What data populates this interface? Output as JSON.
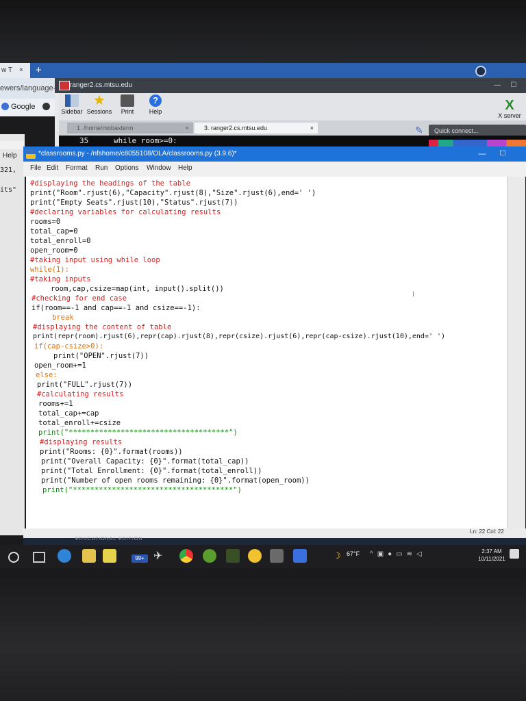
{
  "browser": {
    "tab_label": "w T",
    "tab_close": "×",
    "new_tab": "+",
    "address_partial": "ewers/language-p",
    "bookmarks": [
      "Google",
      ""
    ]
  },
  "mobaxterm": {
    "title": "ranger2.cs.mtsu.edu",
    "min": "—",
    "max": "☐",
    "toolbar": {
      "sidebar": "Sidebar",
      "sessions": "Sessions",
      "print": "Print",
      "help": "Help",
      "xserver": "X server"
    },
    "tabs": [
      {
        "label": "1. /home/mobaxterm",
        "close": "×"
      },
      {
        "label": "3. ranger2.cs.mtsu.edu",
        "close": "×"
      }
    ],
    "quick_connect_placeholder": "Quick connect...",
    "terminal": {
      "line_number": "35",
      "line_text": "while room>=0:"
    }
  },
  "left_window": {
    "help": "Help",
    "line1": "321,",
    "line2": "its\""
  },
  "idle": {
    "title": "*classrooms.py - /nfshome/c8055108/OLA/classrooms.py (3.9.6)*",
    "min": "—",
    "max": "☐",
    "menu": [
      "File",
      "Edit",
      "Format",
      "Run",
      "Options",
      "Window",
      "Help"
    ],
    "status": "Ln: 22  Col: 22"
  },
  "code": [
    "#displaying the headings of the table",
    "print(\"Room\".rjust(6),\"Capacity\".rjust(8),\"Size\".rjust(6),end=' ')",
    "print(\"Empty Seats\".rjust(10),\"Status\".rjust(7))",
    "#declaring variables for calculating results",
    "rooms=0",
    "total_cap=0",
    "total_enroll=0",
    "open_room=0",
    "#taking input using while loop",
    "while(1):",
    "#taking inputs",
    "room,cap,csize=map(int, input().split())",
    "#checking for end case",
    "if(room==-1 and cap==-1 and csize==-1):",
    "break",
    "#displaying the content of table",
    "print(repr(room).rjust(6),repr(cap).rjust(8),repr(csize).rjust(6),repr(cap-csize).rjust(10),end=' ')",
    "if(cap-csize>0):",
    "print(\"OPEN\".rjust(7))",
    "open_room+=1",
    "else:",
    "print(\"FULL\".rjust(7))",
    "#calculating results",
    "rooms+=1",
    "total_cap+=cap",
    "total_enroll+=csize",
    "print(\"*************************************\")",
    "#displaying results",
    "print(\"Rooms: {0}\".format(rooms))",
    "print(\"Overall Capacity: {0}\".format(total_cap))",
    "print(\"Total Enrollment: {0}\".format(total_enroll))",
    "print(\"Number of open rooms remaining: {0}\".format(open_room))",
    "print(\"*************************************\")"
  ],
  "taskbar": {
    "edu_text": "EDUCATIONAL EDITION",
    "badge": "99+",
    "temperature": "67°F",
    "time": "2:37 AM",
    "date": "10/11/2021"
  }
}
